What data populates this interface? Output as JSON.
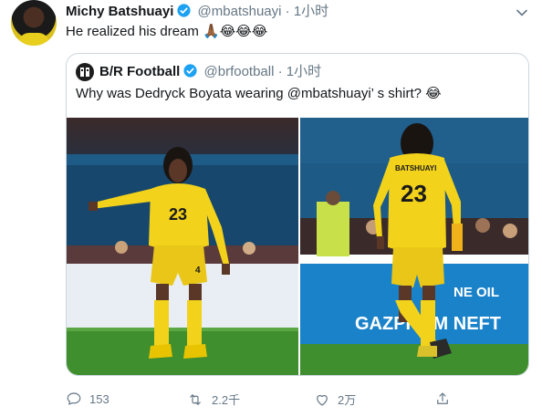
{
  "tweet": {
    "author_name": "Michy Batshuayi",
    "handle": "@mbatshuayi",
    "separator": "·",
    "time": "1小时",
    "text": "He realized his dream",
    "emojis": "🙏🏾😂😂😂"
  },
  "quoted": {
    "author_name": "B/R Football",
    "handle": "@brfootball",
    "separator": "·",
    "time": "1小时",
    "text": "Why was Dedryck Boyata wearing @mbatshuayi’ s shirt?",
    "emoji": "😂",
    "left_jersey_number": "23",
    "left_shorts_number": "4",
    "right_jersey_name": "BATSHUAYI",
    "right_jersey_number": "23",
    "right_board_text_1": "NE OIL",
    "right_board_text_2": "GAZPROM NEFT"
  },
  "actions": {
    "reply_count": "153",
    "retweet_count": "2.2千",
    "like_count": "2万"
  },
  "colors": {
    "accent": "#1da1f2",
    "verified": "#1da1f2",
    "muted": "#657786",
    "jersey": "#f2d21b",
    "pitch": "#3f8f2e"
  }
}
